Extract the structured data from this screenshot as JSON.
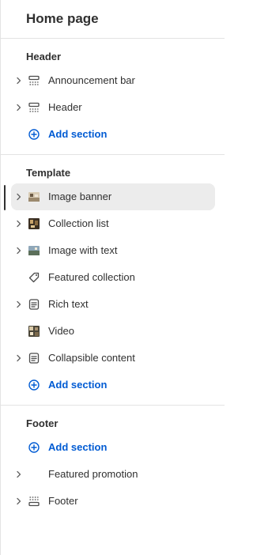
{
  "page": {
    "title": "Home page"
  },
  "groups": [
    {
      "title": "Header"
    },
    {
      "title": "Template"
    },
    {
      "title": "Footer"
    }
  ],
  "header_items": [
    {
      "label": "Announcement bar",
      "icon": "announcement-bar-icon"
    },
    {
      "label": "Header",
      "icon": "header-layout-icon"
    },
    {
      "label": "Add section",
      "icon": "plus-circle-icon"
    }
  ],
  "template_items": [
    {
      "label": "Image banner",
      "icon": "image-thumbnail-icon"
    },
    {
      "label": "Collection list",
      "icon": "collection-thumbnail-icon"
    },
    {
      "label": "Image with text",
      "icon": "image-thumbnail-icon"
    },
    {
      "label": "Featured collection",
      "icon": "tag-icon"
    },
    {
      "label": "Rich text",
      "icon": "text-block-icon"
    },
    {
      "label": "Video",
      "icon": "video-thumbnail-icon"
    },
    {
      "label": "Collapsible content",
      "icon": "text-block-icon"
    },
    {
      "label": "Add section",
      "icon": "plus-circle-icon"
    }
  ],
  "footer_items": [
    {
      "label": "Add section",
      "icon": "plus-circle-icon"
    },
    {
      "label": "Featured promotion",
      "icon": ""
    },
    {
      "label": "Footer",
      "icon": "footer-layout-icon"
    }
  ],
  "colors": {
    "link": "#005bd3",
    "selected_bg": "#ececec",
    "text": "#303030"
  }
}
